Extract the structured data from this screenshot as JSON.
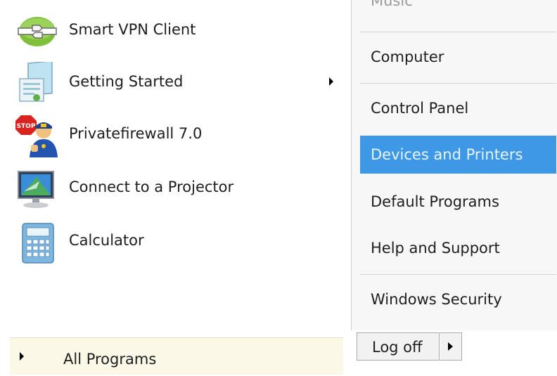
{
  "left_pane": {
    "programs": [
      {
        "label": "Smart VPN Client",
        "icon": "vpn-client-icon",
        "has_submenu": false
      },
      {
        "label": "Getting Started",
        "icon": "getting-started-icon",
        "has_submenu": true
      },
      {
        "label": "Privatefirewall 7.0",
        "icon": "firewall-icon",
        "has_submenu": false
      },
      {
        "label": "Connect to a Projector",
        "icon": "projector-icon",
        "has_submenu": false
      },
      {
        "label": "Calculator",
        "icon": "calculator-icon",
        "has_submenu": false
      }
    ],
    "all_programs_label": "All Programs"
  },
  "right_pane": {
    "items": [
      {
        "label": "Music",
        "partial": true
      },
      {
        "label": "Computer"
      },
      {
        "label": "Control Panel"
      },
      {
        "label": "Devices and Printers",
        "highlighted": true
      },
      {
        "label": "Default Programs"
      },
      {
        "label": "Help and Support"
      },
      {
        "label": "Windows Security"
      }
    ]
  },
  "shutdown": {
    "logoff_label": "Log off"
  },
  "colors": {
    "highlight": "#3e98e6",
    "all_programs_bg": "#fbf8e7",
    "right_pane_bg": "#f7f7f7"
  }
}
